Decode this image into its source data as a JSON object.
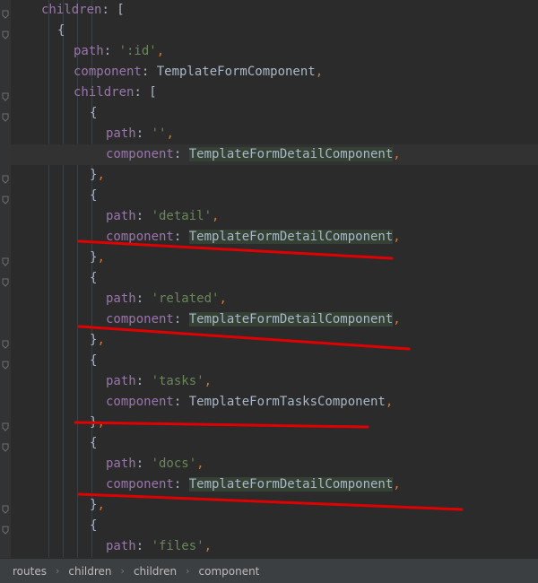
{
  "editor": {
    "lines": [
      {
        "tokens": [
          {
            "t": "children",
            "c": "k"
          },
          {
            "t": ": [",
            "c": "i"
          }
        ]
      },
      {
        "tokens": [
          {
            "t": "{",
            "c": "i"
          }
        ]
      },
      {
        "tokens": [
          {
            "t": "path",
            "c": "k"
          },
          {
            "t": ": ",
            "c": "i"
          },
          {
            "t": "':id'",
            "c": "s"
          },
          {
            "t": ",",
            "c": "p"
          }
        ]
      },
      {
        "tokens": [
          {
            "t": "component",
            "c": "k"
          },
          {
            "t": ": TemplateFormComponent",
            "c": "i"
          },
          {
            "t": ",",
            "c": "p"
          }
        ]
      },
      {
        "tokens": [
          {
            "t": "children",
            "c": "k"
          },
          {
            "t": ": [",
            "c": "i"
          }
        ]
      },
      {
        "tokens": [
          {
            "t": "{",
            "c": "i"
          }
        ]
      },
      {
        "tokens": [
          {
            "t": "path",
            "c": "k"
          },
          {
            "t": ": ",
            "c": "i"
          },
          {
            "t": "''",
            "c": "s"
          },
          {
            "t": ",",
            "c": "p"
          }
        ]
      },
      {
        "tokens": [
          {
            "t": "component",
            "c": "k"
          },
          {
            "t": ": ",
            "c": "i"
          },
          {
            "t": "TemplateFormDetailComponent",
            "c": "hl"
          },
          {
            "t": ",",
            "c": "p"
          }
        ]
      },
      {
        "tokens": [
          {
            "t": "}",
            "c": "i"
          },
          {
            "t": ",",
            "c": "p"
          }
        ]
      },
      {
        "tokens": [
          {
            "t": "{",
            "c": "i"
          }
        ]
      },
      {
        "tokens": [
          {
            "t": "path",
            "c": "k"
          },
          {
            "t": ": ",
            "c": "i"
          },
          {
            "t": "'detail'",
            "c": "s"
          },
          {
            "t": ",",
            "c": "p"
          }
        ]
      },
      {
        "tokens": [
          {
            "t": "component",
            "c": "k"
          },
          {
            "t": ": ",
            "c": "i"
          },
          {
            "t": "TemplateFormDetailComponent",
            "c": "hl"
          },
          {
            "t": ",",
            "c": "p"
          }
        ]
      },
      {
        "tokens": [
          {
            "t": "}",
            "c": "i"
          },
          {
            "t": ",",
            "c": "p"
          }
        ]
      },
      {
        "tokens": [
          {
            "t": "{",
            "c": "i"
          }
        ]
      },
      {
        "tokens": [
          {
            "t": "path",
            "c": "k"
          },
          {
            "t": ": ",
            "c": "i"
          },
          {
            "t": "'related'",
            "c": "s"
          },
          {
            "t": ",",
            "c": "p"
          }
        ]
      },
      {
        "tokens": [
          {
            "t": "component",
            "c": "k"
          },
          {
            "t": ": ",
            "c": "i"
          },
          {
            "t": "TemplateFormDetailComponent",
            "c": "hl"
          },
          {
            "t": ",",
            "c": "p"
          }
        ]
      },
      {
        "tokens": [
          {
            "t": "}",
            "c": "i"
          },
          {
            "t": ",",
            "c": "p"
          }
        ]
      },
      {
        "tokens": [
          {
            "t": "{",
            "c": "i"
          }
        ]
      },
      {
        "tokens": [
          {
            "t": "path",
            "c": "k"
          },
          {
            "t": ": ",
            "c": "i"
          },
          {
            "t": "'tasks'",
            "c": "s"
          },
          {
            "t": ",",
            "c": "p"
          }
        ]
      },
      {
        "tokens": [
          {
            "t": "component",
            "c": "k"
          },
          {
            "t": ": TemplateFormTasksComponent",
            "c": "i"
          },
          {
            "t": ",",
            "c": "p"
          }
        ]
      },
      {
        "tokens": [
          {
            "t": "}",
            "c": "i"
          },
          {
            "t": ",",
            "c": "p"
          }
        ]
      },
      {
        "tokens": [
          {
            "t": "{",
            "c": "i"
          }
        ]
      },
      {
        "tokens": [
          {
            "t": "path",
            "c": "k"
          },
          {
            "t": ": ",
            "c": "i"
          },
          {
            "t": "'docs'",
            "c": "s"
          },
          {
            "t": ",",
            "c": "p"
          }
        ]
      },
      {
        "tokens": [
          {
            "t": "component",
            "c": "k"
          },
          {
            "t": ": ",
            "c": "i"
          },
          {
            "t": "TemplateFormDetailComponent",
            "c": "hl"
          },
          {
            "t": ",",
            "c": "p"
          }
        ]
      },
      {
        "tokens": [
          {
            "t": "}",
            "c": "i"
          },
          {
            "t": ",",
            "c": "p"
          }
        ]
      },
      {
        "tokens": [
          {
            "t": "{",
            "c": "i"
          }
        ]
      },
      {
        "tokens": [
          {
            "t": "path",
            "c": "k"
          },
          {
            "t": ": ",
            "c": "i"
          },
          {
            "t": "'files'",
            "c": "s"
          },
          {
            "t": ",",
            "c": "p"
          }
        ]
      }
    ],
    "colors": {
      "background": "#2b2b2b",
      "property": "#9876aa",
      "string": "#6a8759",
      "punctuation": "#cc7832",
      "text": "#a9b7c6",
      "highlight": "#344134",
      "annotation": "#e00000"
    }
  },
  "statusbar": {
    "breadcrumbs": [
      "routes",
      "children",
      "children",
      "component"
    ]
  }
}
